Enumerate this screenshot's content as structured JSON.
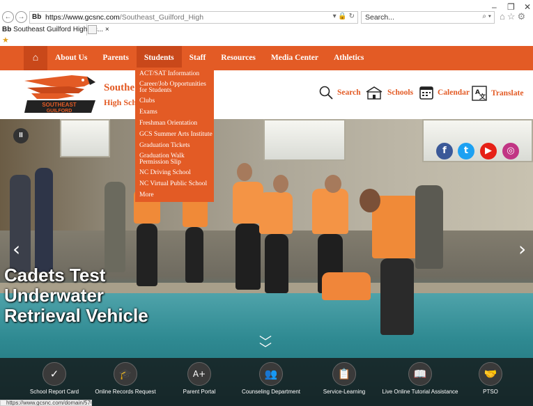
{
  "browser": {
    "url_host": "https://www.gcsnc.com",
    "url_rest": "/Southeast_Guilford_High",
    "favicon": "Bb",
    "search_placeholder": "Search...",
    "tab_title": "Southeast Guilford High Sc...",
    "status_url": "https://www.gcsnc.com/domain/576"
  },
  "nav": {
    "items": [
      {
        "label": "About Us"
      },
      {
        "label": "Parents"
      },
      {
        "label": "Students"
      },
      {
        "label": "Staff"
      },
      {
        "label": "Resources"
      },
      {
        "label": "Media Center"
      },
      {
        "label": "Athletics"
      }
    ]
  },
  "dropdown": {
    "items": [
      "ACT/SAT Information",
      "Career/Job Opportunities for Students",
      "Clubs",
      "Exams",
      "Freshman Orientation",
      "GCS Summer Arts Institute",
      "Graduation Tickets",
      "Graduation Walk Permission Slip",
      "NC Driving School",
      "NC Virtual Public School",
      "More"
    ]
  },
  "header": {
    "school_line1": "Southe",
    "school_line2": "High Scho",
    "logo_text1": "SOUTHEAST",
    "logo_text2": "GUILFORD",
    "links": {
      "search": "Search",
      "schools": "Schools",
      "calendar": "Calendar",
      "translate": "Translate"
    }
  },
  "hero": {
    "caption": [
      "Cadets Test",
      "Underwater",
      "Retrieval Vehicle"
    ],
    "pause": "II"
  },
  "quicklinks": [
    {
      "label": "School Report Card",
      "icon": "check-icon",
      "glyph": "✓"
    },
    {
      "label": "Online Records Request",
      "icon": "graduation-cap-icon",
      "glyph": "🎓"
    },
    {
      "label": "Parent Portal",
      "icon": "grade-a-plus-icon",
      "glyph": "A+"
    },
    {
      "label": "Counseling Department",
      "icon": "people-icon",
      "glyph": "👥"
    },
    {
      "label": "Service-Learning",
      "icon": "clipboard-icon",
      "glyph": "📋"
    },
    {
      "label": "Live Online Tutorial Assistance",
      "icon": "book-icon",
      "glyph": "📖"
    },
    {
      "label": "PTSO",
      "icon": "handshake-icon",
      "glyph": "🤝"
    }
  ],
  "colors": {
    "accent": "#e35b25",
    "accent_dark": "#c9481a"
  }
}
